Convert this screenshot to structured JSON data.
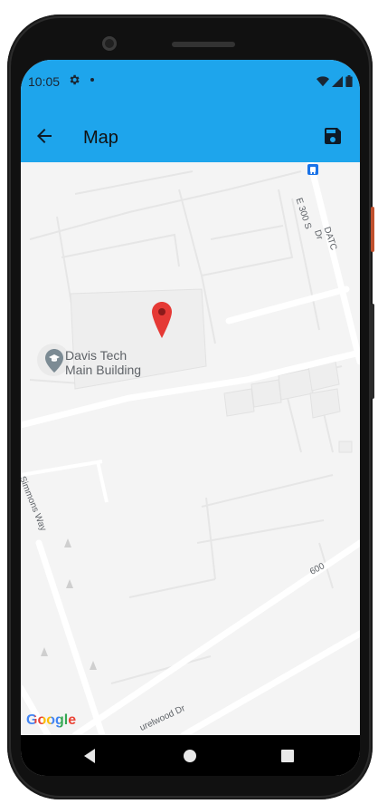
{
  "status_bar": {
    "time": "10:05"
  },
  "app_bar": {
    "title": "Map"
  },
  "map": {
    "poi_name_line1": "Davis Tech",
    "poi_name_line2": "Main Building",
    "street_simmons": "Simmons Way",
    "street_e300s": "E 300 S",
    "street_datc": "DATC Dr",
    "street_600": "600",
    "street_laurelwood": "urelwood Dr",
    "attribution": "Google"
  },
  "colors": {
    "accent": "#1ea5ec",
    "marker": "#e53935",
    "map_bg": "#f4f4f4",
    "road": "#ffffff"
  },
  "icons": [
    "arrow-left-icon",
    "save-icon",
    "gear-icon",
    "wifi-icon",
    "signal-icon",
    "battery-icon",
    "bus-stop-icon",
    "map-pin-icon",
    "graduation-cap-icon",
    "back-triangle-icon",
    "home-circle-icon",
    "recents-square-icon"
  ]
}
